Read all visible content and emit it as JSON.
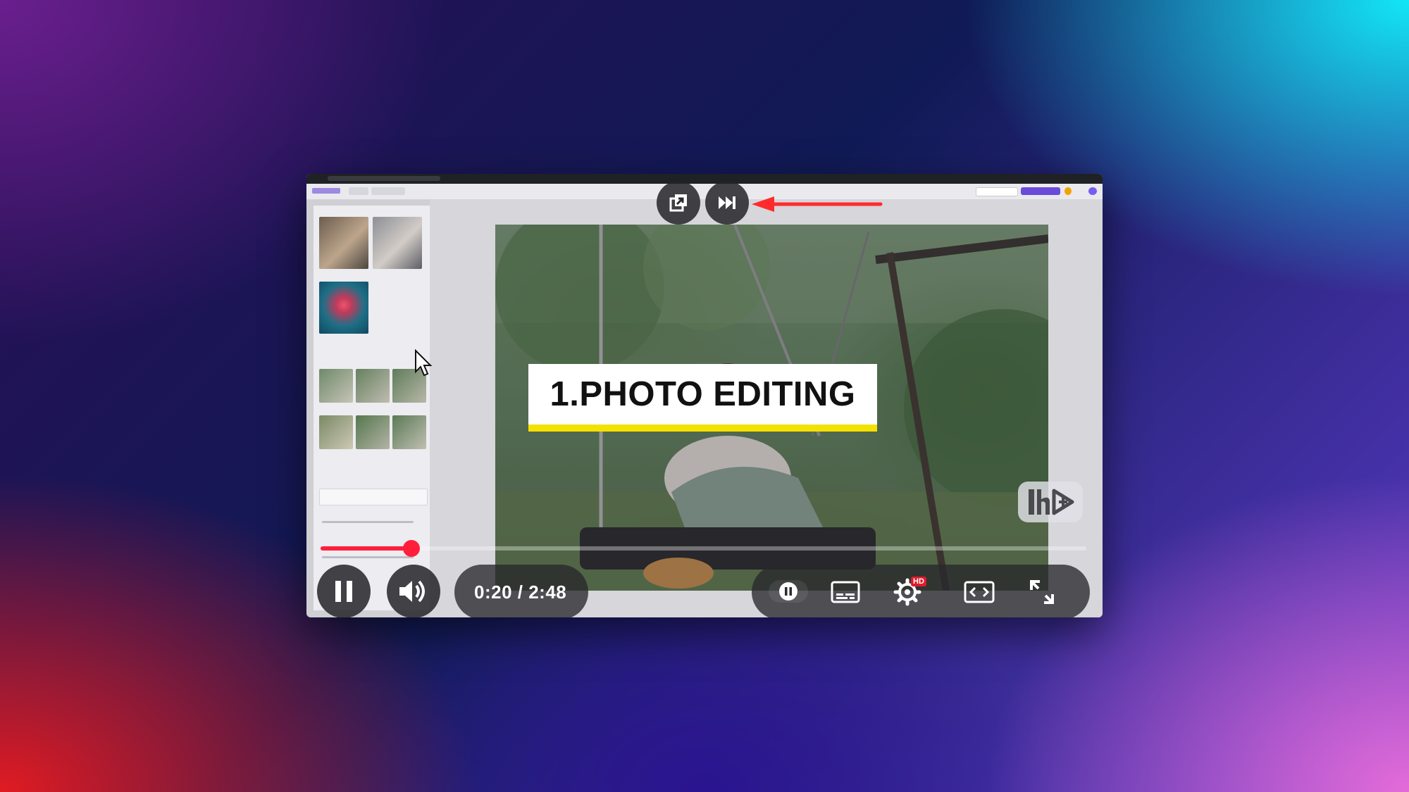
{
  "video": {
    "title_card": "1.PHOTO EDITING",
    "time_display": "0:20 / 2:48",
    "progress_fraction": 0.119,
    "hd_badge": "HD"
  },
  "controls": {
    "miniplayer": "miniplayer-icon",
    "next": "next-icon",
    "play_pause": "pause-icon",
    "volume": "volume-icon",
    "autoplay": "autoplay-toggle-icon",
    "captions": "captions-icon",
    "settings": "settings-icon",
    "theater": "theater-mode-icon",
    "fullscreen": "fullscreen-icon"
  },
  "colors": {
    "progress": "#ff1f3a",
    "title_underline": "#f5e100",
    "annotation_arrow": "#ff2b2b"
  }
}
